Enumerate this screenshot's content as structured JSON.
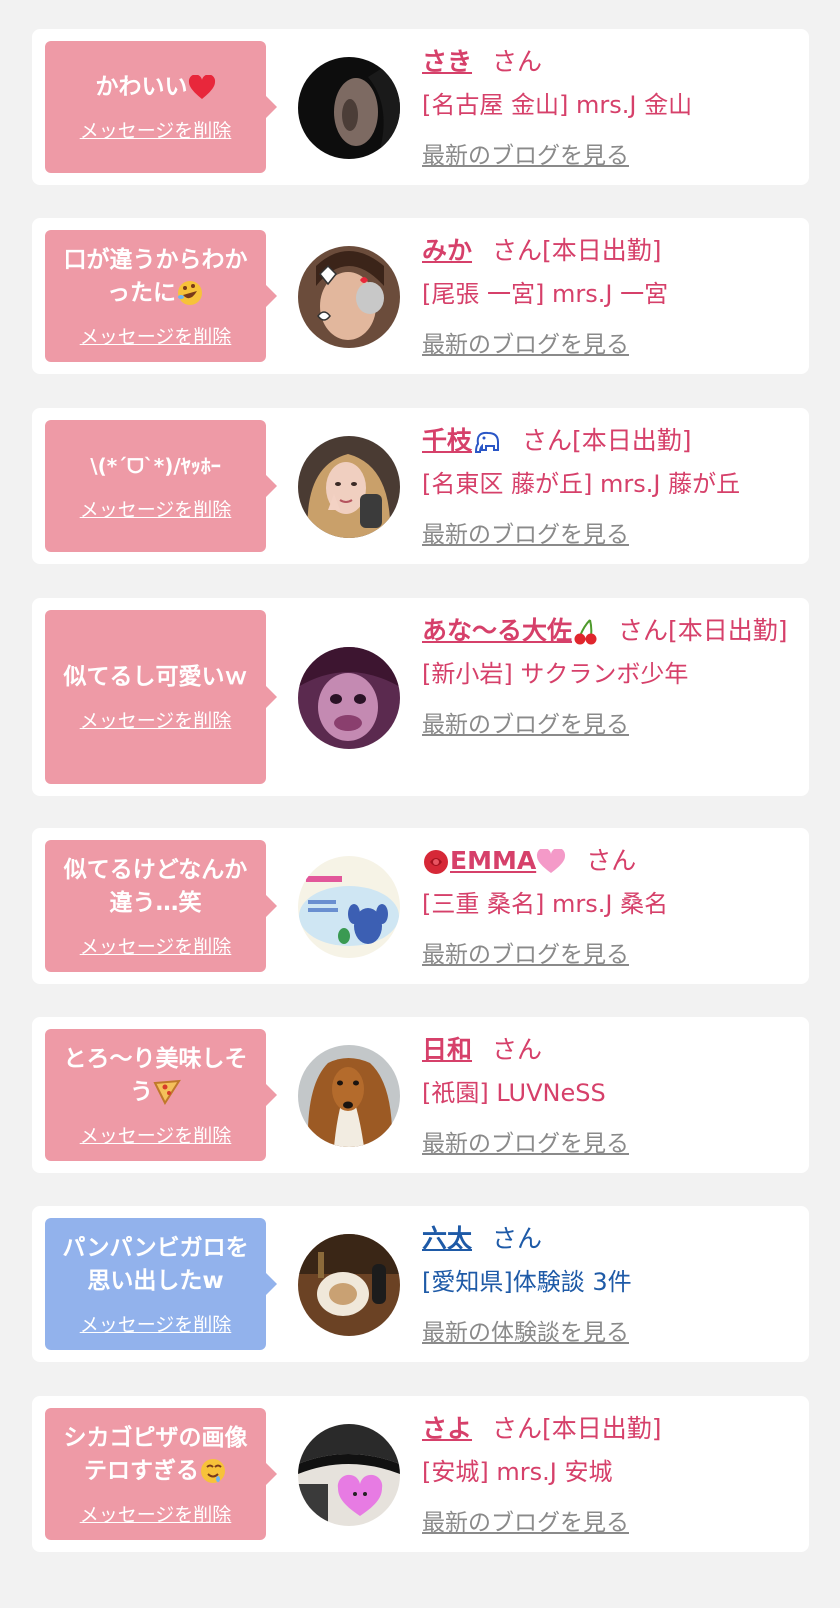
{
  "messages": [
    {
      "bubble_text": "かわいい",
      "bubble_emoji": "heart",
      "delete_label": "メッセージを削除",
      "name": "さき",
      "honorific": "さん",
      "shop": "[名古屋 金山] mrs.J 金山",
      "blog_label": "最新のブログを見る",
      "avatar_icon": "avatar-ear-dark"
    },
    {
      "bubble_text": "口が違うからわかったに",
      "bubble_emoji": "rofl",
      "delete_label": "メッセージを削除",
      "name": "みか",
      "honorific": "さん[本日出勤]",
      "shop": "[尾張 一宮] mrs.J 一宮",
      "blog_label": "最新のブログを見る",
      "avatar_icon": "avatar-selfie-cat"
    },
    {
      "bubble_text": "\\(*´ᗜ`*)/ﾔｯﾎｰ",
      "bubble_emoji": "",
      "delete_label": "メッセージを削除",
      "name": "千枝",
      "name_emoji": "elephant",
      "honorific": "さん[本日出勤]",
      "shop": "[名東区 藤が丘] mrs.J 藤が丘",
      "blog_label": "最新のブログを見る",
      "avatar_icon": "avatar-blonde-woman"
    },
    {
      "bubble_text": "似てるし可愛いｗ",
      "bubble_emoji": "",
      "delete_label": "メッセージを削除",
      "name": "あな〜る大佐",
      "name_emoji": "cherry",
      "honorific": "さん[本日出勤]",
      "shop": "[新小岩] サクランボ少年",
      "blog_label": "最新のブログを見る",
      "avatar_icon": "avatar-purple-face"
    },
    {
      "bubble_text": "似てるけどなんか違う…笑",
      "bubble_emoji": "",
      "delete_label": "メッセージを削除",
      "name_emoji_before": "rose",
      "name": "EMMA",
      "name_emoji": "pink-heart",
      "honorific": "さん",
      "shop": "[三重 桑名] mrs.J 桑名",
      "blog_label": "最新のブログを見る",
      "avatar_icon": "avatar-stitch"
    },
    {
      "bubble_text": "とろ〜り美味しそう",
      "bubble_emoji": "pizza",
      "delete_label": "メッセージを削除",
      "name": "日和",
      "honorific": "さん",
      "shop": "[祇園] LUVNeSS",
      "blog_label": "最新のブログを見る",
      "avatar_icon": "avatar-collie-dog"
    },
    {
      "bubble_text": "パンパンビガロを思い出したw",
      "bubble_emoji": "",
      "delete_label": "メッセージを削除",
      "name": "六太",
      "honorific": "さん",
      "shop": "[愛知県]体験談 3件",
      "blog_label": "最新の体験談を見る",
      "avatar_icon": "avatar-food-plate",
      "theme": "blue"
    },
    {
      "bubble_text": "シカゴピザの画像テロすぎる",
      "bubble_emoji": "drool",
      "delete_label": "メッセージを削除",
      "name": "さよ",
      "honorific": "さん[本日出勤]",
      "shop": "[安城] mrs.J 安城",
      "blog_label": "最新のブログを見る",
      "avatar_icon": "avatar-hat-heart"
    }
  ],
  "colors": {
    "page_bg": "#f2f2f2",
    "card_bg": "#ffffff",
    "bubble_pink": "#ee9aa6",
    "bubble_blue": "#92b2ec",
    "text_pink": "#d6406a",
    "text_blue": "#1e5aa7",
    "link_gray": "#8a8a8a"
  }
}
